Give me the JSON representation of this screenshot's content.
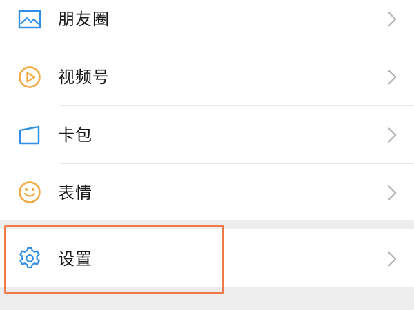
{
  "menu": {
    "items": [
      {
        "label": "朋友圈",
        "icon": "moments-photo-icon",
        "color": "#2f8ee8"
      },
      {
        "label": "视频号",
        "icon": "channels-play-icon",
        "color": "#f0a63c"
      },
      {
        "label": "卡包",
        "icon": "card-wallet-icon",
        "color": "#2f8ee8"
      },
      {
        "label": "表情",
        "icon": "smiley-face-icon",
        "color": "#f0a63c"
      }
    ],
    "settings": {
      "label": "设置",
      "icon": "gear-icon",
      "color": "#2f8ee8"
    }
  },
  "colors": {
    "background": "#ededed",
    "row_bg": "#ffffff",
    "text": "#191919",
    "chevron": "#b2b2b2",
    "highlight_border": "#f07a4a"
  }
}
